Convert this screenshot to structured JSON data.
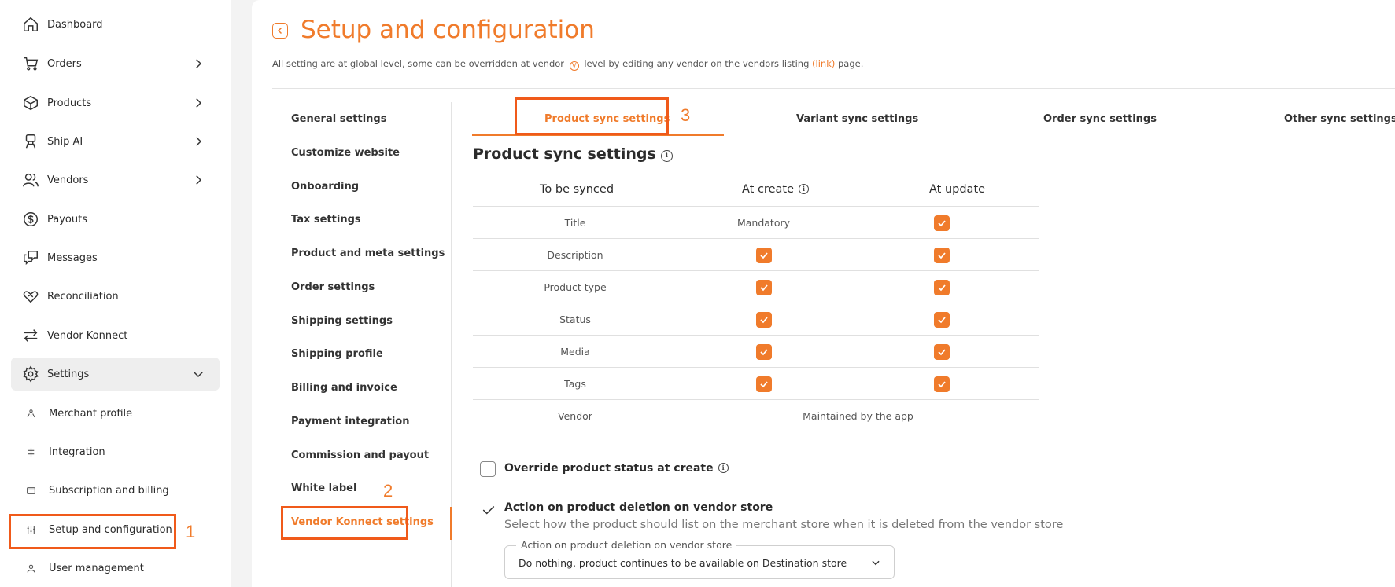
{
  "sidebar": {
    "items": [
      {
        "label": "Dashboard",
        "icon": "home-icon"
      },
      {
        "label": "Orders",
        "icon": "cart-icon"
      },
      {
        "label": "Products",
        "icon": "box-icon"
      },
      {
        "label": "Ship AI",
        "icon": "robot-icon"
      },
      {
        "label": "Vendors",
        "icon": "users-icon"
      },
      {
        "label": "Payouts",
        "icon": "dollar-icon"
      },
      {
        "label": "Messages",
        "icon": "chat-icon"
      },
      {
        "label": "Reconciliation",
        "icon": "handshake-icon"
      },
      {
        "label": "Vendor Konnect",
        "icon": "arrows-icon"
      },
      {
        "label": "Settings",
        "icon": "gear-icon"
      }
    ],
    "sub_items": [
      {
        "label": "Merchant profile",
        "icon": "merchant-icon"
      },
      {
        "label": "Integration",
        "icon": "integration-icon"
      },
      {
        "label": "Subscription and billing",
        "icon": "billing-icon"
      },
      {
        "label": "Setup and configuration",
        "icon": "sliders-icon"
      },
      {
        "label": "User management",
        "icon": "user-icon"
      }
    ]
  },
  "annotations": {
    "step1": "1",
    "step2": "2",
    "step3": "3"
  },
  "header": {
    "title": "Setup and configuration",
    "subtitle_pre": "All setting are at global level, some can be overridden at vendor",
    "subtitle_v": "V",
    "subtitle_mid": "level by editing any vendor on the vendors listing",
    "subtitle_link": "(link)",
    "subtitle_post": "page."
  },
  "settings_menu": [
    "General settings",
    "Customize website",
    "Onboarding",
    "Tax settings",
    "Product and meta settings",
    "Order settings",
    "Shipping settings",
    "Shipping profile",
    "Billing and invoice",
    "Payment integration",
    "Commission and payout",
    "White label",
    "Vendor Konnect settings"
  ],
  "tabs": [
    "Product sync settings",
    "Variant sync settings",
    "Order sync settings",
    "Other sync settings"
  ],
  "section": {
    "title": "Product sync settings",
    "info": "i"
  },
  "table": {
    "headers": [
      "To be synced",
      "At create",
      "At update"
    ],
    "rows": [
      {
        "field": "Title",
        "create_text": "Mandatory"
      },
      {
        "field": "Description"
      },
      {
        "field": "Product type"
      },
      {
        "field": "Status"
      },
      {
        "field": "Media"
      },
      {
        "field": "Tags"
      },
      {
        "field": "Vendor",
        "merged_text": "Maintained by the app"
      }
    ]
  },
  "options": {
    "override_label": "Override product status at create",
    "deletion_label": "Action on product deletion on vendor store",
    "deletion_desc": "Select how the product should list on the merchant store when it is deleted from the vendor store",
    "select_legend": "Action on product deletion on vendor store",
    "select_value": "Do nothing, product continues to be available on Destination store"
  },
  "colors": {
    "accent": "#f07b2b",
    "highlight": "#f05a1a"
  }
}
